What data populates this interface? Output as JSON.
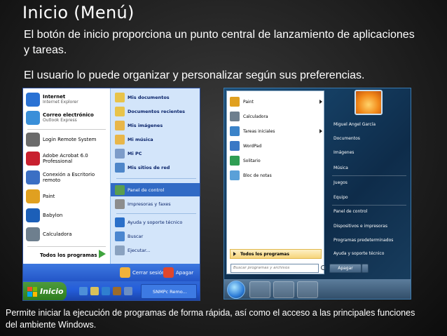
{
  "slide": {
    "title": "Inicio (Menú)",
    "bullet1": "El botón de inicio proporciona un punto central de lanzamiento de aplicaciones y tareas.",
    "bullet2": "El usuario lo puede organizar y personalizar según sus preferencias.",
    "caption": "Permite iniciar la ejecución de programas de forma rápida, así como el acceso a las principales funciones del ambiente Windows."
  },
  "xp_menu": {
    "pinned": [
      {
        "title": "Internet",
        "subtitle": "Internet Explorer",
        "icon": "internet-explorer-icon",
        "color": "#2a72d4"
      },
      {
        "title": "Correo electrónico",
        "subtitle": "Outlook Express",
        "icon": "outlook-express-icon",
        "color": "#3a8fd9"
      }
    ],
    "recent": [
      {
        "label": "Login Remote System",
        "icon": "remote-login-icon",
        "color": "#6b6b6b"
      },
      {
        "label": "Adobe Acrobat 6.0 Professional",
        "icon": "acrobat-icon",
        "color": "#c8202f"
      },
      {
        "label": "Conexión a Escritorio remoto",
        "icon": "remote-desktop-icon",
        "color": "#3b6fc4"
      },
      {
        "label": "Paint",
        "icon": "paint-icon",
        "color": "#e0a020"
      },
      {
        "label": "Babylon",
        "icon": "babylon-icon",
        "color": "#1c5fb8"
      },
      {
        "label": "Calculadora",
        "icon": "calculator-icon",
        "color": "#6e7f8e"
      }
    ],
    "all_programs": "Todos los programas",
    "right": [
      {
        "label": "Mis documentos",
        "icon": "my-documents-icon",
        "color": "#e8c34a",
        "bold": true
      },
      {
        "label": "Documentos recientes",
        "icon": "recent-documents-icon",
        "color": "#e8c34a",
        "bold": true
      },
      {
        "label": "Mis imágenes",
        "icon": "my-pictures-icon",
        "color": "#e8b64a",
        "bold": true
      },
      {
        "label": "Mi música",
        "icon": "my-music-icon",
        "color": "#e8b64a",
        "bold": true
      },
      {
        "label": "Mi PC",
        "icon": "my-computer-icon",
        "color": "#7d9cc9",
        "bold": true
      },
      {
        "label": "Mis sitios de red",
        "icon": "network-places-icon",
        "color": "#4e86c9",
        "bold": true
      },
      {
        "label": "Panel de control",
        "icon": "control-panel-icon",
        "color": "#5a9e4f",
        "bold": false
      },
      {
        "label": "Impresoras y faxes",
        "icon": "printers-icon",
        "color": "#8d8d8d",
        "bold": false
      },
      {
        "label": "Ayuda y soporte técnico",
        "icon": "help-icon",
        "color": "#2a6fc9",
        "bold": false
      },
      {
        "label": "Buscar",
        "icon": "search-icon",
        "color": "#4a86d0",
        "bold": false
      },
      {
        "label": "Ejecutar...",
        "icon": "run-icon",
        "color": "#8aa2c0",
        "bold": false
      }
    ],
    "log_off": "Cerrar sesión",
    "shut_down": "Apagar",
    "start_label": "Inicio",
    "task_label": "SNMPc Remo..."
  },
  "w7_menu": {
    "pinned": [
      {
        "label": "Paint",
        "icon": "paint-icon",
        "color": "#e0a020",
        "submenu": true
      },
      {
        "label": "Calculadora",
        "icon": "calculator-icon",
        "color": "#6e7f8e",
        "submenu": false
      },
      {
        "label": "Tareas iniciales",
        "icon": "getting-started-icon",
        "color": "#3b83c9",
        "submenu": true
      },
      {
        "label": "WordPad",
        "icon": "wordpad-icon",
        "color": "#3a78c5",
        "submenu": false
      },
      {
        "label": "Solitario",
        "icon": "solitaire-icon",
        "color": "#2f9e53",
        "submenu": false
      },
      {
        "label": "Bloc de notas",
        "icon": "notepad-icon",
        "color": "#5aa0d8",
        "submenu": false
      }
    ],
    "all_programs": "Todos los programas",
    "search_placeholder": "Buscar programas y archivos",
    "user": "Miguel Angel García",
    "right": [
      "Documentos",
      "Imágenes",
      "Música",
      "Juegos",
      "Equipo",
      "Panel de control",
      "Dispositivos e impresoras",
      "Programas predeterminados",
      "Ayuda y soporte técnico"
    ],
    "shut_down": "Apagar"
  }
}
